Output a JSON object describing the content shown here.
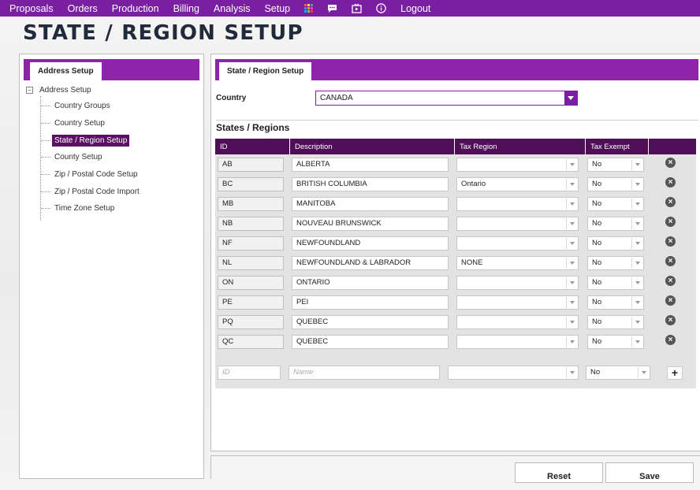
{
  "nav": {
    "links": [
      "Proposals",
      "Orders",
      "Production",
      "Billing",
      "Analysis",
      "Setup"
    ],
    "logout": "Logout",
    "icons": [
      "apps-grid-icon",
      "chat-icon",
      "media-icon",
      "info-icon"
    ]
  },
  "page_title": "STATE / REGION SETUP",
  "left": {
    "tab": "Address Setup",
    "tree_root": "Address Setup",
    "tree_expander": "−",
    "items": [
      "Country Groups",
      "Country Setup",
      "State / Region Setup",
      "County Setup",
      "Zip / Postal Code Setup",
      "Zip / Postal Code Import",
      "Time Zone Setup"
    ],
    "selected_index": 2
  },
  "right": {
    "tab": "State / Region Setup",
    "country_label": "Country",
    "country_value": "CANADA",
    "section_title": "States / Regions",
    "columns": [
      "ID",
      "Description",
      "Tax Region",
      "Tax Exempt"
    ],
    "rows": [
      {
        "id": "AB",
        "description": "ALBERTA",
        "tax_region": "",
        "tax_exempt": "No"
      },
      {
        "id": "BC",
        "description": "BRITISH COLUMBIA",
        "tax_region": "Ontario",
        "tax_exempt": "No"
      },
      {
        "id": "MB",
        "description": "MANITOBA",
        "tax_region": "",
        "tax_exempt": "No"
      },
      {
        "id": "NB",
        "description": "NOUVEAU BRUNSWICK",
        "tax_region": "",
        "tax_exempt": "No"
      },
      {
        "id": "NF",
        "description": "NEWFOUNDLAND",
        "tax_region": "",
        "tax_exempt": "No"
      },
      {
        "id": "NL",
        "description": "NEWFOUNDLAND & LABRADOR",
        "tax_region": "NONE",
        "tax_exempt": "No"
      },
      {
        "id": "ON",
        "description": "ONTARIO",
        "tax_region": "",
        "tax_exempt": "No"
      },
      {
        "id": "PE",
        "description": "PEI",
        "tax_region": "",
        "tax_exempt": "No"
      },
      {
        "id": "PQ",
        "description": "QUEBEC",
        "tax_region": "",
        "tax_exempt": "No"
      },
      {
        "id": "QC",
        "description": "QUEBEC",
        "tax_region": "",
        "tax_exempt": "No"
      }
    ],
    "delete_symbol": "×",
    "new_row": {
      "id_placeholder": "ID",
      "name_placeholder": "Name",
      "tax_exempt": "No",
      "add_symbol": "+"
    }
  },
  "buttons": {
    "reset": "Reset",
    "save": "Save"
  },
  "colors": {
    "accent": "#7b1fa2",
    "header": "#4f0f57",
    "selected": "#5c1063"
  }
}
